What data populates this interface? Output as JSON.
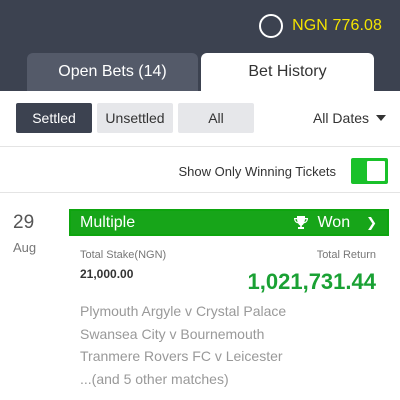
{
  "header": {
    "balance": "NGN 776.08",
    "tabs": [
      {
        "label": "Open Bets (14)",
        "active": false
      },
      {
        "label": "Bet History",
        "active": true
      }
    ]
  },
  "filters": {
    "options": [
      {
        "label": "Settled",
        "selected": true
      },
      {
        "label": "Unsettled",
        "selected": false
      },
      {
        "label": "All",
        "selected": false
      }
    ],
    "dates_label": "All Dates"
  },
  "winning_toggle": {
    "label": "Show Only Winning Tickets",
    "on": true
  },
  "bet": {
    "day": "29",
    "month": "Aug",
    "type": "Multiple",
    "status": "Won",
    "stake_label": "Total Stake(NGN)",
    "stake_value": "21,000.00",
    "return_label": "Total Return",
    "return_value": "1,021,731.44",
    "matches": [
      "Plymouth Argyle v Crystal Palace",
      "Swansea City v Bournemouth",
      "Tranmere Rovers FC v Leicester",
      "...(and 5 other matches)"
    ]
  },
  "colors": {
    "header_bg": "#3c4250",
    "balance_text": "#f4e400",
    "won_green": "#17a519",
    "return_green": "#1aa134",
    "toggle_green": "#19c12a"
  },
  "icons": [
    "balance-circle-icon",
    "caret-down-icon",
    "trophy-icon",
    "chevron-right-icon"
  ]
}
